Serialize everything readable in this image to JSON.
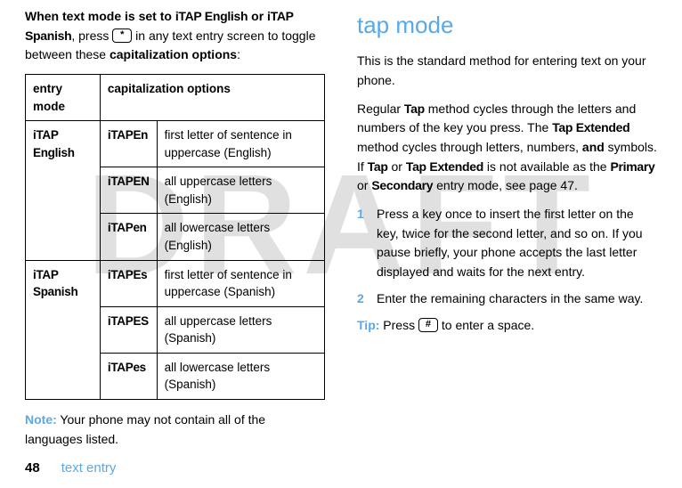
{
  "watermark": "DRAFT",
  "left": {
    "intro_prefix": "When text mode is set to ",
    "intro_mode1": "iTAP English",
    "intro_or": " or ",
    "intro_mode2": "iTAP Spanish",
    "intro_mid1": ", press ",
    "intro_key": "*",
    "intro_mid2": " in any text entry screen to toggle between these ",
    "intro_bold_tail": "capitalization options",
    "intro_colon": ":",
    "th_mode": "entry mode",
    "th_opts": "capitalization options",
    "rows": {
      "eng_label": "iTAP English",
      "eng1_code": "iTAPEn",
      "eng1_desc": "first letter of sentence in uppercase (English)",
      "eng2_code": "iTAPEN",
      "eng2_desc": "all uppercase letters (English)",
      "eng3_code": "iTAPen",
      "eng3_desc": "all lowercase letters (English)",
      "spa_label": "iTAP Spanish",
      "spa1_code": "iTAPEs",
      "spa1_desc": "first letter of sentence in uppercase (Spanish)",
      "spa2_code": "iTAPES",
      "spa2_desc": "all uppercase letters (Spanish)",
      "spa3_code": "iTAPes",
      "spa3_desc": "all lowercase letters (Spanish)"
    },
    "note_label": "Note:",
    "note_text": " Your phone may not contain all of the languages listed."
  },
  "right": {
    "heading": "tap mode",
    "p1": "This is the standard method for entering text on your phone.",
    "p2_a": "Regular ",
    "p2_tap": "Tap",
    "p2_b": " method cycles through the letters and numbers of the key you press. The ",
    "p2_tapext": "Tap Extended",
    "p2_c": " method cycles through letters, numbers, ",
    "p2_and": "and",
    "p2_d": " symbols. If ",
    "p2_tap2": "Tap",
    "p2_e": " or ",
    "p2_tapext2": "Tap Extended",
    "p2_f": " is not available as the ",
    "p2_primary": "Primary",
    "p2_g": " or ",
    "p2_secondary": "Secondary",
    "p2_h": " entry mode, see page 47.",
    "step1_num": "1",
    "step1": "Press a key once to insert the first letter on the key, twice for the second letter, and so on. If you pause briefly, your phone accepts the last letter displayed and waits for the next entry.",
    "step2_num": "2",
    "step2": "Enter the remaining characters in the same way.",
    "tip_label": "Tip:",
    "tip_a": " Press ",
    "tip_key": "#",
    "tip_b": " to enter a space."
  },
  "footer": {
    "page": "48",
    "section": "text entry"
  }
}
